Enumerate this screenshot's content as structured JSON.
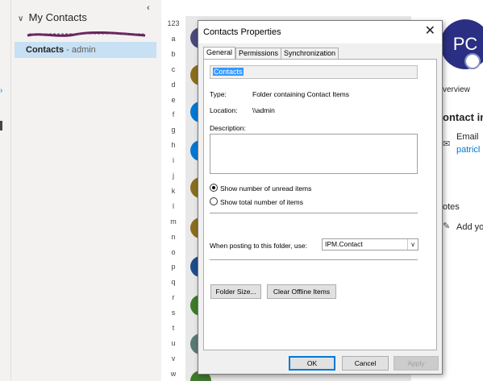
{
  "folder_pane": {
    "collapse_glyph": "‹",
    "group_chevron": "∨",
    "group_label": "My Contacts",
    "selected_folder": {
      "name": "Contacts",
      "suffix": " - admin"
    }
  },
  "contact_list": {
    "alphabet": [
      "123",
      "a",
      "b",
      "c",
      "d",
      "e",
      "f",
      "g",
      "h",
      "i",
      "j",
      "k",
      "l",
      "m",
      "n",
      "o",
      "p",
      "q",
      "r",
      "s",
      "t",
      "u",
      "v",
      "w"
    ]
  },
  "reading_pane": {
    "avatar_initials": "PC",
    "overview_tab": "verview",
    "contact_info_heading": "ontact in",
    "email_label": "Email",
    "email_value": "patricl",
    "notes_heading": "otes",
    "add_note": "Add yo"
  },
  "dialog": {
    "title": "Contacts Properties",
    "close_glyph": "✕",
    "tabs": [
      "General",
      "Permissions",
      "Synchronization"
    ],
    "name_value": "Contacts",
    "type_label": "Type:",
    "type_value": "Folder containing Contact Items",
    "location_label": "Location:",
    "location_value": "\\\\admin",
    "description_label": "Description:",
    "radio_unread": "Show number of unread items",
    "radio_total": "Show total number of items",
    "posting_label": "When posting to this folder, use:",
    "posting_value": "IPM.Contact",
    "folder_size_button": "Folder Size...",
    "clear_offline_button": "Clear Offline Items",
    "ok_button": "OK",
    "cancel_button": "Cancel",
    "apply_button": "Apply"
  },
  "colors": {
    "selected_folder_bg": "#c7e0f4",
    "avatar_bg": "#2b2f83",
    "link": "#0078d4",
    "scribble": "#6b1f5e"
  }
}
